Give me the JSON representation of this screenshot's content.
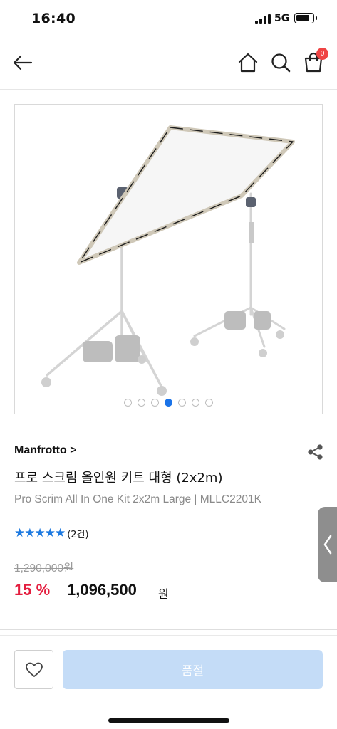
{
  "status": {
    "time": "16:40",
    "network": "5G",
    "icons": [
      "signal-icon",
      "battery-icon"
    ]
  },
  "nav": {
    "icons": [
      "arrow-left-icon",
      "home-icon",
      "search-icon",
      "shopping-bag-icon"
    ],
    "cart_count": "0"
  },
  "gallery": {
    "image_icon": "scrim-kit-photo",
    "slide_total": 7,
    "active_slide": 4
  },
  "product": {
    "brand": "Manfrotto >",
    "title_ko": "프로 스크림 올인원 키트 대형 (2x2m)",
    "title_en": "Pro Scrim All In One Kit 2x2m Large | MLLC2201K",
    "stars": "★★★★★",
    "rating_value": 5,
    "review_count": "(2건)",
    "original_price": "1,290,000원",
    "discount": "15 %",
    "sale_price": "1,096,500",
    "currency": "원",
    "share_icon": "share-icon"
  },
  "bottom_bar": {
    "wish_icon": "heart-icon",
    "soldout_label": "품절"
  },
  "side_tab_icon": "chevron-left-icon",
  "colors": {
    "accent": "#1a73e8",
    "star": "#1e7ae0",
    "discount": "#e41e3f",
    "badge": "#ef4444",
    "disabled_button": "#c4dcf7"
  }
}
